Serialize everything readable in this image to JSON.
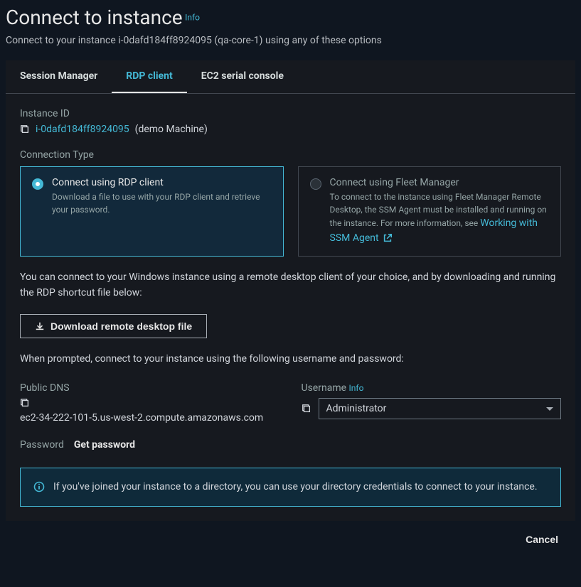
{
  "header": {
    "title": "Connect to instance",
    "info": "Info",
    "subtitle": "Connect to your instance i-0dafd184ff8924095 (qa-core-1) using any of these options"
  },
  "tabs": [
    {
      "label": "Session Manager"
    },
    {
      "label": "RDP client"
    },
    {
      "label": "EC2 serial console"
    }
  ],
  "instance": {
    "label": "Instance ID",
    "id": "i-0dafd184ff8924095",
    "name": "(demo Machine)"
  },
  "connection_type": {
    "label": "Connection Type",
    "options": [
      {
        "title": "Connect using RDP client",
        "desc": "Download a file to use with your RDP client and retrieve your password."
      },
      {
        "title": "Connect using Fleet Manager",
        "desc": "To connect to the instance using Fleet Manager Remote Desktop, the SSM Agent must be installed and running on the instance. For more information, see ",
        "link": "Working with SSM Agent"
      }
    ]
  },
  "instructions": "You can connect to your Windows instance using a remote desktop client of your choice, and by downloading and running the RDP shortcut file below:",
  "download_btn": "Download remote desktop file",
  "prompt_text": "When prompted, connect to your instance using the following username and password:",
  "public_dns": {
    "label": "Public DNS",
    "value": "ec2-34-222-101-5.us-west-2.compute.amazonaws.com"
  },
  "username": {
    "label": "Username",
    "info": "Info",
    "value": "Administrator"
  },
  "password": {
    "label": "Password",
    "action": "Get password"
  },
  "info_box": "If you've joined your instance to a directory, you can use your directory credentials to connect to your instance.",
  "footer": {
    "cancel": "Cancel"
  }
}
